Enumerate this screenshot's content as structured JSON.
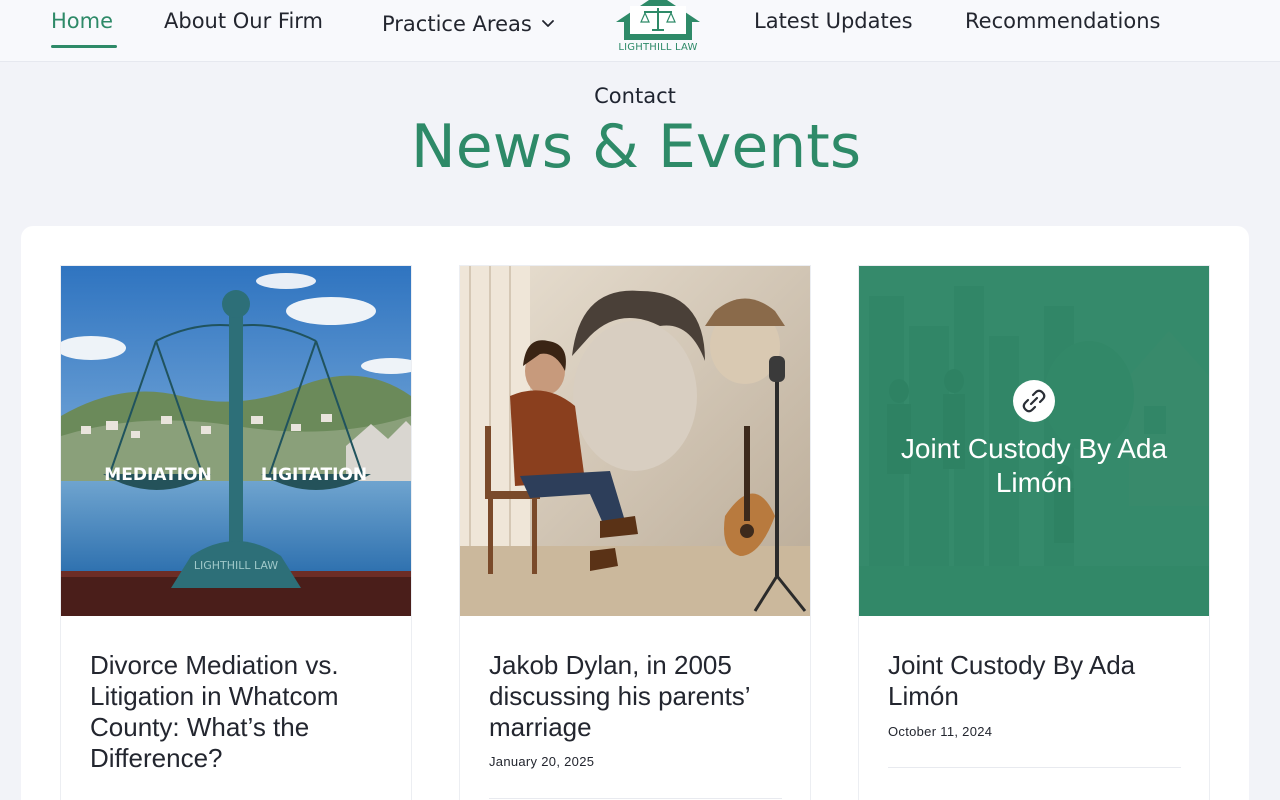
{
  "nav": {
    "home": "Home",
    "about": "About Our Firm",
    "practice": "Practice Areas",
    "updates": "Latest Updates",
    "recommendations": "Recommendations",
    "contact": "Contact"
  },
  "logo": {
    "text": "LIGHTHILL LAW"
  },
  "page": {
    "title": "News & Events"
  },
  "posts": [
    {
      "title": "Divorce Mediation vs. Litigation in Whatcom County: What’s the Difference?",
      "image_labels": {
        "left_pan": "MEDIATION",
        "right_pan": "LIGITATION",
        "base": "LIGHTHILL LAW"
      }
    },
    {
      "title": "Jakob Dylan, in 2005 discussing his parents’ marriage",
      "date": "January 20, 2025"
    },
    {
      "title": "Joint Custody By Ada Limón",
      "overlay_title": "Joint Custody By Ada Limón",
      "date": "October 11, 2024"
    }
  ],
  "colors": {
    "accent": "#2e8a68",
    "background": "#f2f3f8",
    "text": "#23262f"
  },
  "icons": {
    "practice_dropdown": "chevron-down-icon",
    "post_link": "link-icon"
  }
}
